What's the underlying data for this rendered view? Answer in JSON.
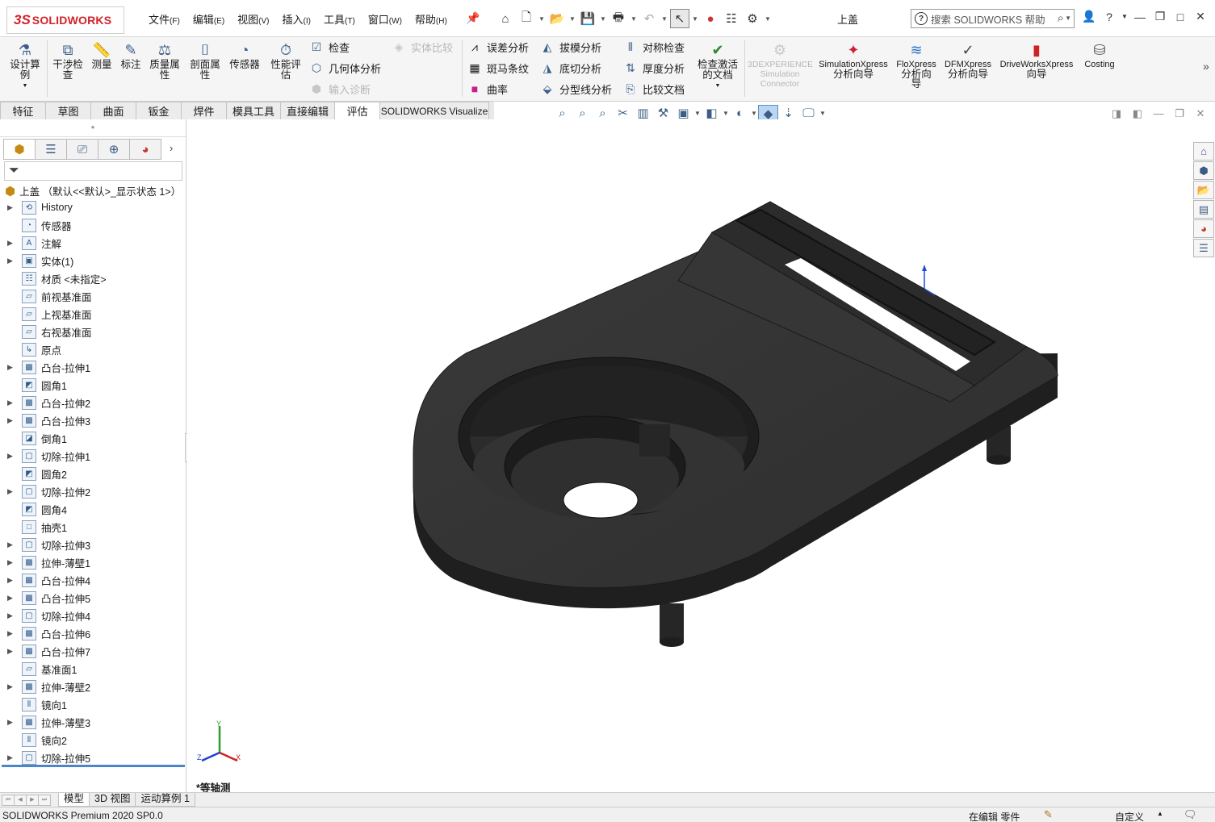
{
  "app": {
    "logo_ds": "3S",
    "logo_text": "SOLIDWORKS",
    "document_title": "上盖",
    "search_placeholder": "搜索 SOLIDWORKS 帮助"
  },
  "menu": [
    {
      "label": "文件",
      "accel": "(F)"
    },
    {
      "label": "编辑",
      "accel": "(E)"
    },
    {
      "label": "视图",
      "accel": "(V)"
    },
    {
      "label": "插入",
      "accel": "(I)"
    },
    {
      "label": "工具",
      "accel": "(T)"
    },
    {
      "label": "窗口",
      "accel": "(W)"
    },
    {
      "label": "帮助",
      "accel": "(H)"
    }
  ],
  "quick_access_icons": [
    "home-icon",
    "new-document-icon",
    "open-icon",
    "save-icon",
    "print-icon",
    "undo-icon",
    "select-arrow-icon",
    "rebuild-traffic-light-icon",
    "file-properties-icon",
    "options-gear-icon"
  ],
  "ribbon": {
    "design_study": "设计算例",
    "interference_check": "干涉检查",
    "measure": "测量",
    "markup": "标注",
    "mass_properties": "质量属性",
    "section_properties": "剖面属性",
    "sensor": "传感器",
    "performance_evaluation": "性能评估",
    "check": "检查",
    "geometry_analysis": "几何体分析",
    "import_diagnostics": "输入诊断",
    "compare_bodies": "实体比较",
    "deviation_analysis": "误差分析",
    "zebra_stripes": "斑马条纹",
    "curvature": "曲率",
    "draft_analysis": "拔模分析",
    "undercut_analysis": "底切分析",
    "parting_line_analysis": "分型线分析",
    "symmetry_check": "对称检查",
    "thickness_analysis": "厚度分析",
    "compare_documents": "比较文档",
    "check_active_document": "检查激活的文档",
    "threedx_line1": "3DEXPERIENCE",
    "threedx_line2": "Simulation",
    "threedx_line3": "Connector",
    "simxpress_line1": "SimulationXpress",
    "simxpress_line2": "分析向导",
    "floxpress_line1": "FloXpress",
    "floxpress_line2": "分析向",
    "floxpress_line3": "导",
    "dfmxpress_line1": "DFMXpress",
    "dfmxpress_line2": "分析向导",
    "driveworks_line1": "DriveWorksXpress",
    "driveworks_line2": "向导",
    "costing": "Costing"
  },
  "tabs": [
    "特征",
    "草图",
    "曲面",
    "钣金",
    "焊件",
    "模具工具",
    "直接编辑",
    "评估",
    "SOLIDWORKS Visualize"
  ],
  "active_tab": "评估",
  "feature_tree": {
    "root": "上盖 （默认<<默认>_显示状态 1>）",
    "nodes": [
      {
        "label": "History",
        "expandable": true,
        "icon": "history-icon"
      },
      {
        "label": "传感器",
        "expandable": false,
        "icon": "sensor-icon"
      },
      {
        "label": "注解",
        "expandable": true,
        "icon": "annotations-icon"
      },
      {
        "label": "实体(1)",
        "expandable": true,
        "icon": "solid-bodies-icon"
      },
      {
        "label": "材质 <未指定>",
        "expandable": false,
        "icon": "material-icon"
      },
      {
        "label": "前视基准面",
        "expandable": false,
        "icon": "plane-icon"
      },
      {
        "label": "上视基准面",
        "expandable": false,
        "icon": "plane-icon"
      },
      {
        "label": "右视基准面",
        "expandable": false,
        "icon": "plane-icon"
      },
      {
        "label": "原点",
        "expandable": false,
        "icon": "origin-icon"
      },
      {
        "label": "凸台-拉伸1",
        "expandable": true,
        "icon": "boss-extrude-icon"
      },
      {
        "label": "圆角1",
        "expandable": false,
        "icon": "fillet-icon"
      },
      {
        "label": "凸台-拉伸2",
        "expandable": true,
        "icon": "boss-extrude-icon"
      },
      {
        "label": "凸台-拉伸3",
        "expandable": true,
        "icon": "boss-extrude-icon"
      },
      {
        "label": "倒角1",
        "expandable": false,
        "icon": "chamfer-icon"
      },
      {
        "label": "切除-拉伸1",
        "expandable": true,
        "icon": "cut-extrude-icon"
      },
      {
        "label": "圆角2",
        "expandable": false,
        "icon": "fillet-icon"
      },
      {
        "label": "切除-拉伸2",
        "expandable": true,
        "icon": "cut-extrude-icon"
      },
      {
        "label": "圆角4",
        "expandable": false,
        "icon": "fillet-icon"
      },
      {
        "label": "抽壳1",
        "expandable": false,
        "icon": "shell-icon"
      },
      {
        "label": "切除-拉伸3",
        "expandable": true,
        "icon": "cut-extrude-icon"
      },
      {
        "label": "拉伸-薄壁1",
        "expandable": true,
        "icon": "thin-extrude-icon"
      },
      {
        "label": "凸台-拉伸4",
        "expandable": true,
        "icon": "boss-extrude-icon"
      },
      {
        "label": "凸台-拉伸5",
        "expandable": true,
        "icon": "boss-extrude-icon"
      },
      {
        "label": "切除-拉伸4",
        "expandable": true,
        "icon": "cut-extrude-icon"
      },
      {
        "label": "凸台-拉伸6",
        "expandable": true,
        "icon": "boss-extrude-icon"
      },
      {
        "label": "凸台-拉伸7",
        "expandable": true,
        "icon": "boss-extrude-icon"
      },
      {
        "label": "基准面1",
        "expandable": false,
        "icon": "plane-icon"
      },
      {
        "label": "拉伸-薄壁2",
        "expandable": true,
        "icon": "thin-extrude-icon"
      },
      {
        "label": "镜向1",
        "expandable": false,
        "icon": "mirror-icon"
      },
      {
        "label": "拉伸-薄壁3",
        "expandable": true,
        "icon": "thin-extrude-icon"
      },
      {
        "label": "镜向2",
        "expandable": false,
        "icon": "mirror-icon"
      },
      {
        "label": "切除-拉伸5",
        "expandable": true,
        "icon": "cut-extrude-icon"
      }
    ]
  },
  "viewport": {
    "view_orientation": "*等轴测",
    "triad_labels": {
      "x": "X",
      "y": "Y",
      "z": "Z"
    },
    "part_color": "#333333"
  },
  "bottom_tabs": [
    "模型",
    "3D 视图",
    "运动算例 1"
  ],
  "status": {
    "product": "SOLIDWORKS Premium 2020 SP0.0",
    "editing": "在编辑 零件",
    "units": "自定义"
  },
  "colors": {
    "brand": "#d0232a",
    "accent": "#4a86c8",
    "part": "#333333"
  }
}
